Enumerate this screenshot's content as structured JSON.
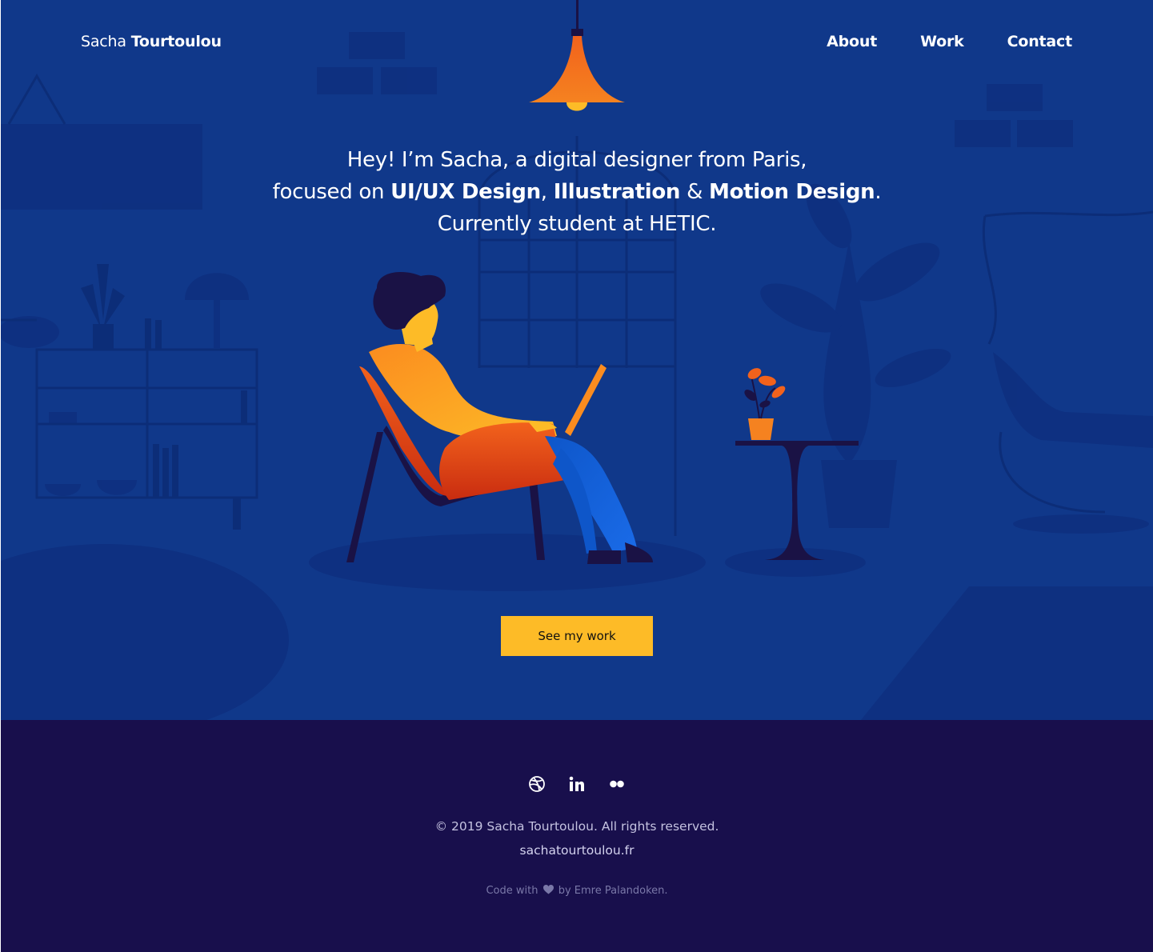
{
  "header": {
    "brand_first": "Sacha",
    "brand_last": "Tourtoulou",
    "nav": [
      {
        "label": "About"
      },
      {
        "label": "Work"
      },
      {
        "label": "Contact"
      }
    ]
  },
  "hero": {
    "line1": "Hey! I’m Sacha, a digital designer from Paris,",
    "line2_prefix": "focused on ",
    "skill1": "UI/UX Design",
    "comma": ", ",
    "skill2": "Illustration",
    "amp": " & ",
    "skill3": "Motion Design",
    "period": ".",
    "line3": "Currently student at HETIC.",
    "cta_label": "See my work"
  },
  "footer": {
    "socials": [
      {
        "icon": "dribbble-icon"
      },
      {
        "icon": "linkedin-icon"
      },
      {
        "icon": "flickr-icon"
      }
    ],
    "copyright": "© 2019 Sacha Tourtoulou. All rights reserved.",
    "site": "sachatourtoulou.fr",
    "credit_prefix": "Code with",
    "credit_suffix": "by Emre Palandoken."
  },
  "colors": {
    "hero_bg": "#10388a",
    "footer_bg": "#180f4c",
    "cta": "#fdbb27",
    "accent_orange": "#f2621c"
  }
}
